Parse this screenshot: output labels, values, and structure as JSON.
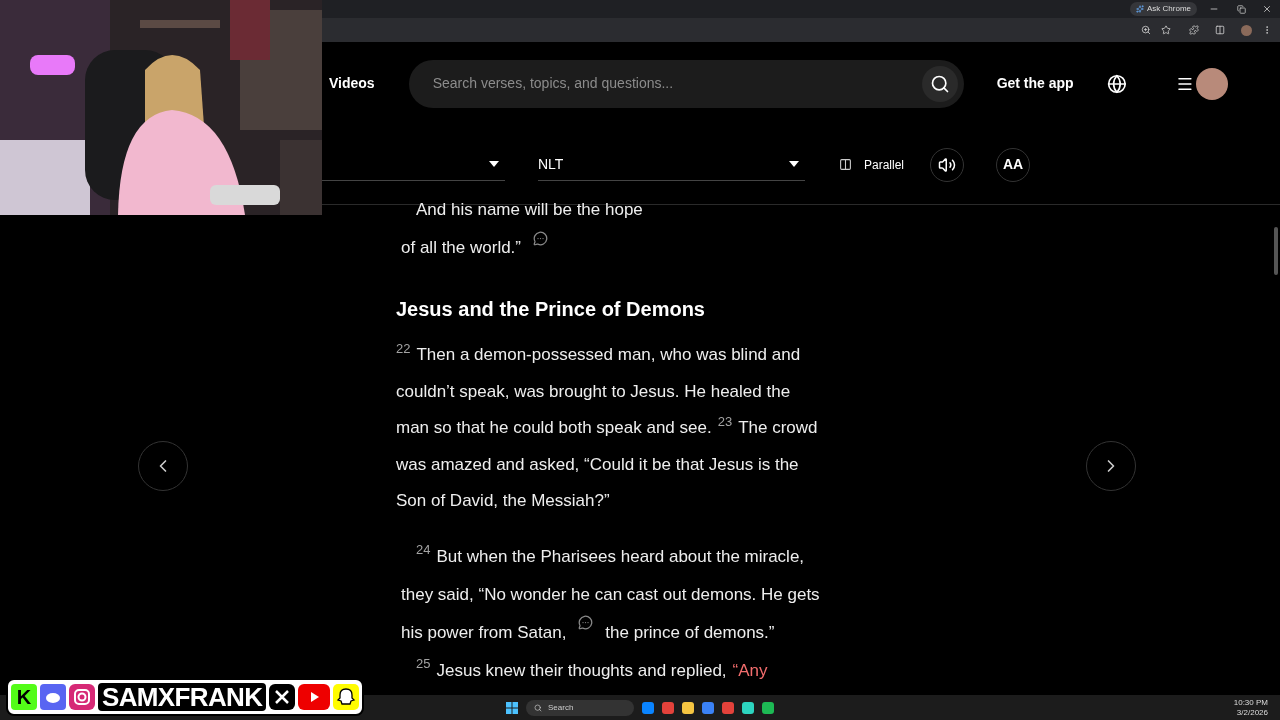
{
  "browser": {
    "ask_button": "Ask Chrome"
  },
  "nav": {
    "videos": "Videos",
    "search_placeholder": "Search verses, topics, and questions...",
    "get_app": "Get the app"
  },
  "toolbar": {
    "version": "NLT",
    "parallel": "Parallel",
    "text_size": "AA"
  },
  "content": [
    {
      "kind": "poetry",
      "lines": [
        [
          {
            "kind": "text",
            "text": "And his name will be the hope"
          }
        ],
        [
          {
            "kind": "text",
            "text": "of all the world.”"
          },
          {
            "kind": "note"
          }
        ]
      ]
    },
    {
      "kind": "heading",
      "text": "Jesus and the Prince of Demons"
    },
    {
      "kind": "paragraph",
      "lines": [
        [
          {
            "kind": "verse",
            "text": "22"
          },
          {
            "kind": "text",
            "text": "Then a demon-possessed man, who was blind and"
          }
        ],
        [
          {
            "kind": "text",
            "text": "couldn’t speak, was brought to Jesus. He healed the"
          }
        ],
        [
          {
            "kind": "text",
            "text": "man so that he could both speak and see."
          },
          {
            "kind": "verse",
            "text": "23"
          },
          {
            "kind": "text",
            "text": "The crowd"
          }
        ],
        [
          {
            "kind": "text",
            "text": "was amazed and asked, “Could it be that Jesus is the"
          }
        ],
        [
          {
            "kind": "text",
            "text": "Son of David, the Messiah?”"
          }
        ]
      ]
    },
    {
      "kind": "poetry",
      "lines": [
        [
          {
            "kind": "verse",
            "text": "24"
          },
          {
            "kind": "text",
            "text": "But when the Pharisees heard about the miracle,"
          }
        ],
        [
          {
            "kind": "text",
            "text": "they said, “No wonder he can cast out demons. He gets"
          }
        ],
        [
          {
            "kind": "text",
            "text": "his power from Satan,"
          },
          {
            "kind": "note"
          },
          {
            "kind": "text",
            "text": "the prince of demons.”"
          }
        ],
        [
          {
            "kind": "verse",
            "text": "25"
          },
          {
            "kind": "text",
            "text": "Jesus knew their thoughts and replied,"
          },
          {
            "kind": "red",
            "text": "“Any"
          }
        ]
      ]
    }
  ],
  "taskbar": {
    "search": "Search",
    "time": "10:30 PM",
    "date": "3/2/2026"
  },
  "overlay": {
    "kick": "K",
    "handle": "SAMXFRANK"
  }
}
